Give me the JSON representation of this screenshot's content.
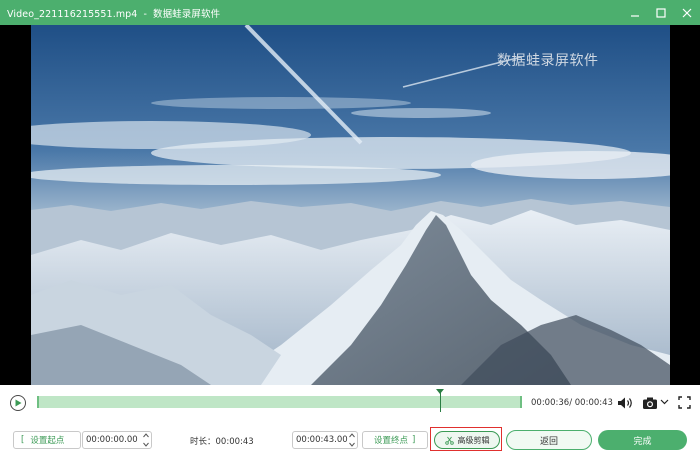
{
  "window": {
    "filename": "Video_221116215551.mp4",
    "separator": "-",
    "app_name": "数据蛙录屏软件"
  },
  "video": {
    "watermark": "数据蛙录屏软件"
  },
  "player": {
    "current_time": "00:00:36",
    "total_time": "00:00:43",
    "time_separator": "/ ",
    "playhead_fraction": 0.83
  },
  "trim": {
    "set_start_label": "设置起点",
    "start_value": "00:00:00.00",
    "duration_label": "时长：",
    "duration_value": "00:00:43",
    "end_value": "00:00:43.00",
    "set_end_label": "设置终点",
    "bracket_open": "[",
    "bracket_close": "]"
  },
  "actions": {
    "advanced_edit_label": "高级剪辑",
    "back_label": "返回",
    "done_label": "完成"
  },
  "colors": {
    "brand": "#4caf6e",
    "highlight": "#e0302e"
  }
}
